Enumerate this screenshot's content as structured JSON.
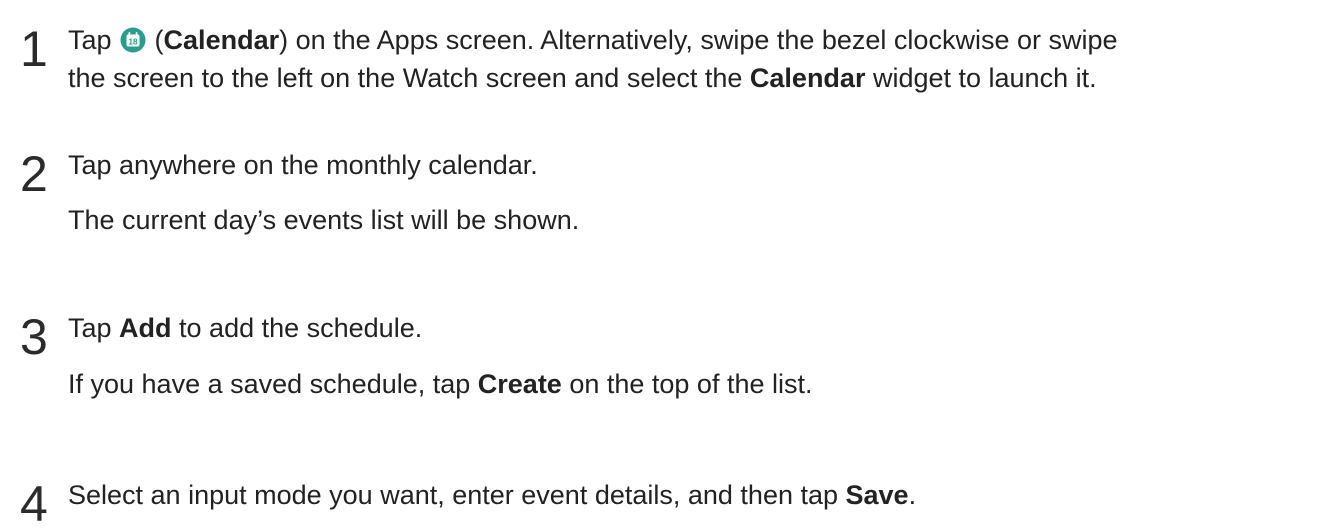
{
  "steps": [
    {
      "number": "1",
      "lines": [
        {
          "parts": [
            {
              "t": "Tap "
            },
            {
              "icon": "calendar-app-icon",
              "icon_text": "18",
              "icon_color": "#2a9d8f"
            },
            {
              "t": " ("
            },
            {
              "t": "Calendar",
              "b": true
            },
            {
              "t": ") on the Apps screen. Alternatively, swipe the bezel clockwise or swipe"
            }
          ]
        },
        {
          "parts": [
            {
              "t": "the screen to the left on the Watch screen and select the "
            },
            {
              "t": "Calendar",
              "b": true
            },
            {
              "t": " widget to launch it."
            }
          ]
        }
      ]
    },
    {
      "number": "2",
      "lines": [
        {
          "parts": [
            {
              "t": "Tap anywhere on the monthly calendar."
            }
          ]
        },
        {
          "parts": [
            {
              "t": "The current day’s events list will be shown."
            }
          ]
        }
      ]
    },
    {
      "number": "3",
      "lines": [
        {
          "parts": [
            {
              "t": "Tap "
            },
            {
              "t": "Add",
              "b": true
            },
            {
              "t": " to add the schedule."
            }
          ]
        },
        {
          "parts": [
            {
              "t": "If you have a saved schedule, tap "
            },
            {
              "t": "Create",
              "b": true
            },
            {
              "t": " on the top of the list."
            }
          ]
        }
      ]
    },
    {
      "number": "4",
      "lines": [
        {
          "parts": [
            {
              "t": "Select an input mode you want, enter event details, and then tap "
            },
            {
              "t": "Save",
              "b": true
            },
            {
              "t": "."
            }
          ]
        }
      ]
    }
  ]
}
